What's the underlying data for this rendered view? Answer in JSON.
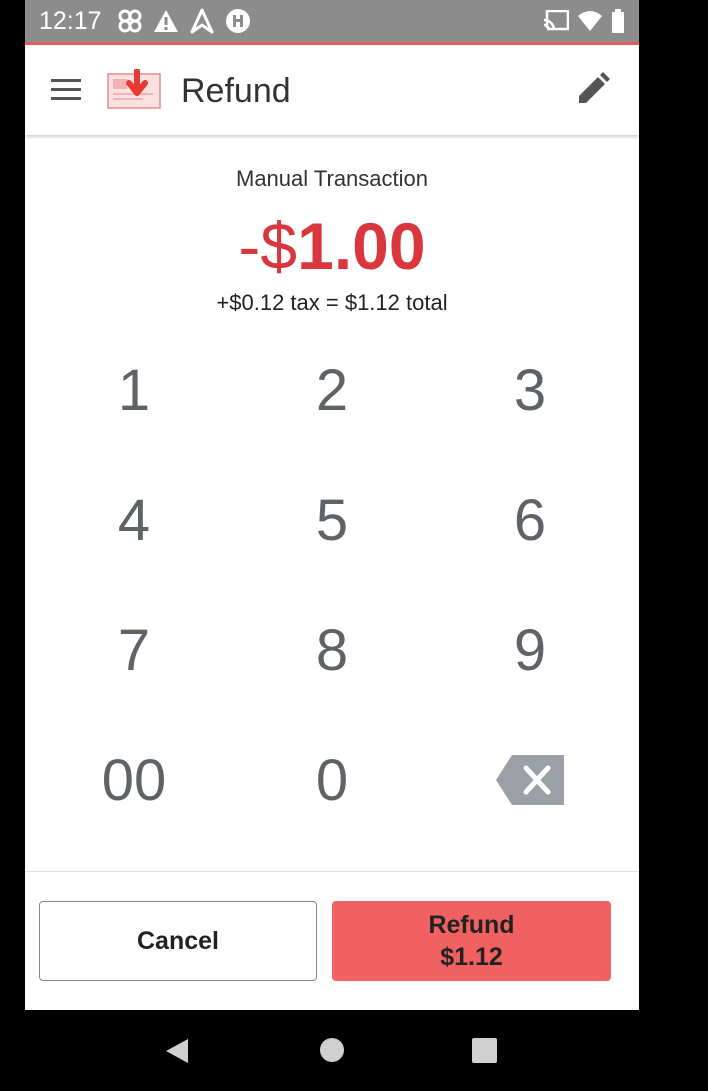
{
  "status_bar": {
    "time": "12:17",
    "left_icons": [
      "fan-icon",
      "warning-icon",
      "navigation-icon",
      "alert-badge-icon"
    ],
    "right_icons": [
      "cast-icon",
      "wifi-icon",
      "battery-icon"
    ]
  },
  "app_bar": {
    "title": "Refund",
    "menu_icon": "hamburger-menu-icon",
    "logo_icon": "refund-card-icon",
    "edit_icon": "pencil-icon"
  },
  "transaction": {
    "label": "Manual Transaction",
    "amount_sign": "-",
    "amount_currency": "$",
    "amount_value": "1.00",
    "tax_line": "+$0.12 tax = $1.12 total"
  },
  "keypad": {
    "keys": [
      "1",
      "2",
      "3",
      "4",
      "5",
      "6",
      "7",
      "8",
      "9",
      "00",
      "0"
    ],
    "backspace_icon": "backspace-icon"
  },
  "actions": {
    "cancel_label": "Cancel",
    "refund_label_line1": "Refund",
    "refund_label_line2": "$1.12"
  },
  "nav_bar": {
    "icons": [
      "back-icon",
      "home-icon",
      "recents-icon"
    ]
  },
  "colors": {
    "accent_red": "#d9363e",
    "refund_button": "#f26161",
    "status_bar": "#8c8c8c"
  }
}
